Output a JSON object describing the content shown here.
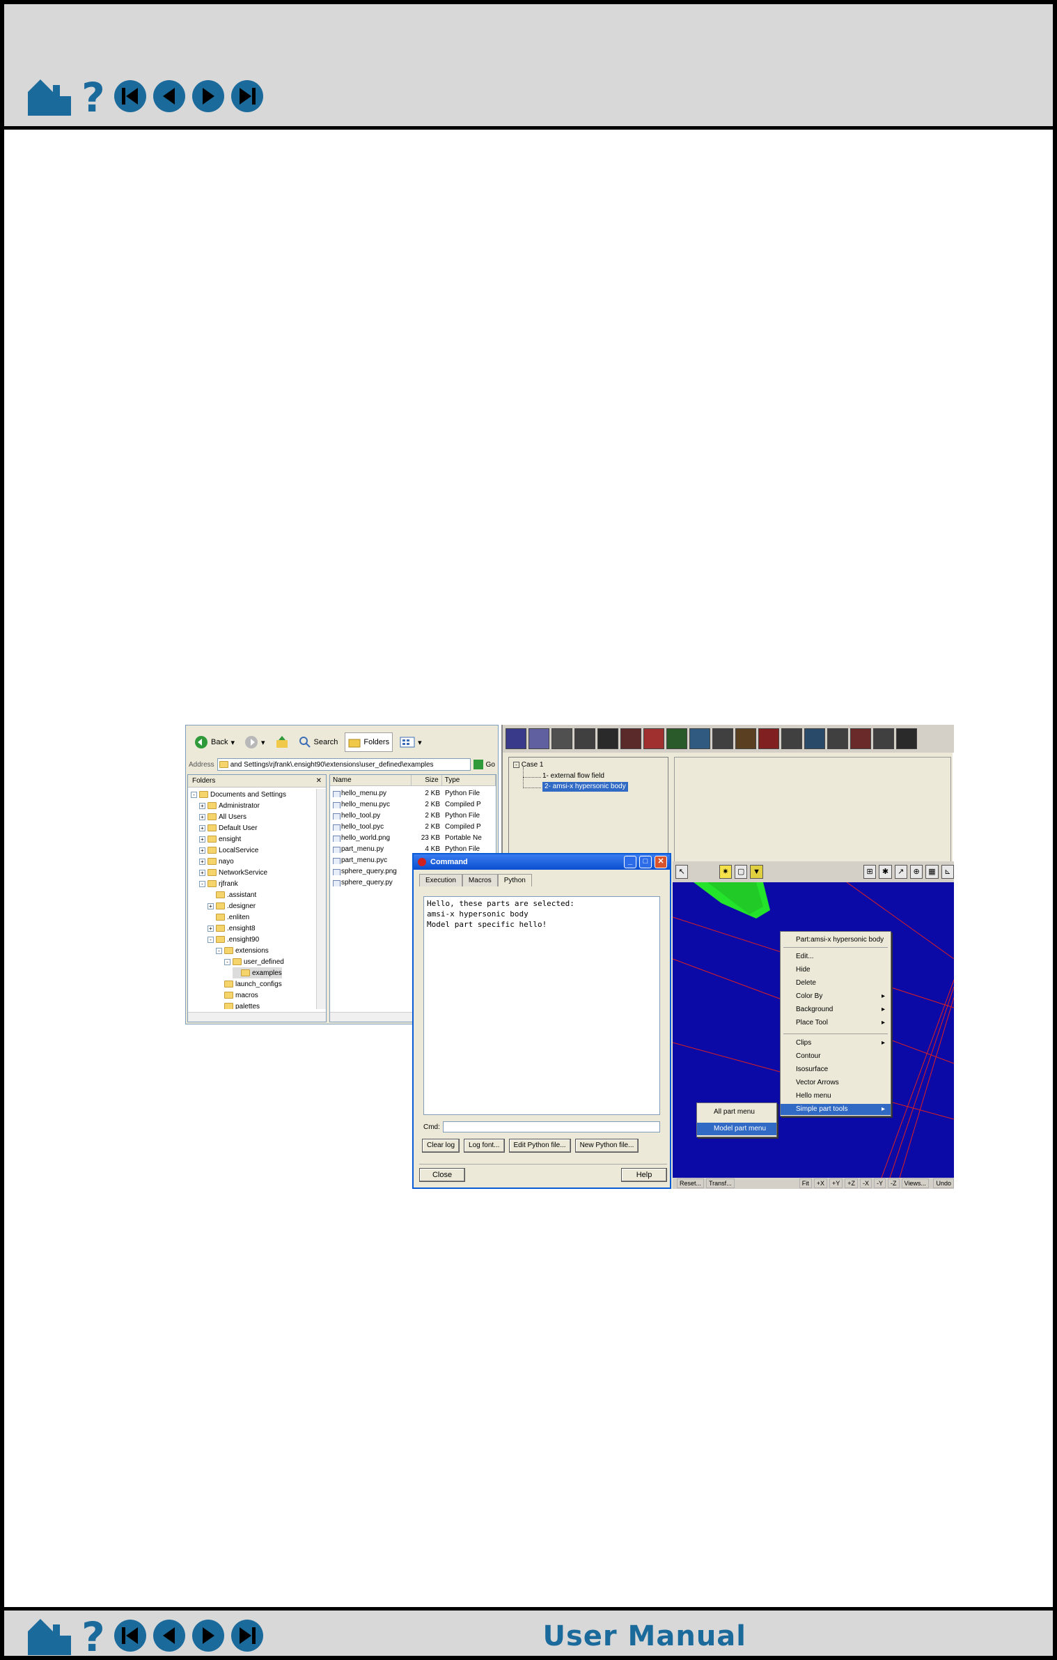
{
  "nav": {
    "icons": [
      "home-icon",
      "help-icon",
      "first-page-icon",
      "previous-page-icon",
      "next-page-icon",
      "last-page-icon"
    ],
    "footer_title": "User Manual",
    "accent_color": "#1b6a9c"
  },
  "explorer": {
    "back_label": "Back",
    "search_label": "Search",
    "folders_label": "Folders",
    "address_label": "Address",
    "address_value": "and Settings\\rjfrank\\.ensight90\\extensions\\user_defined\\examples",
    "go_label": "Go",
    "folders_header": "Folders",
    "tree": [
      {
        "label": "Documents and Settings",
        "pm": "-"
      },
      {
        "label": "Administrator",
        "pm": "+"
      },
      {
        "label": "All Users",
        "pm": "+"
      },
      {
        "label": "Default User",
        "pm": "+"
      },
      {
        "label": "ensight",
        "pm": "+"
      },
      {
        "label": "LocalService",
        "pm": "+"
      },
      {
        "label": "nayo",
        "pm": "+"
      },
      {
        "label": "NetworkService",
        "pm": "+"
      },
      {
        "label": "rjfrank",
        "pm": "-"
      },
      {
        "label": ".assistant",
        "pm": ""
      },
      {
        "label": ".designer",
        "pm": "+"
      },
      {
        "label": ".enliten",
        "pm": ""
      },
      {
        "label": ".ensight8",
        "pm": "+"
      },
      {
        "label": ".ensight90",
        "pm": "-"
      },
      {
        "label": "extensions",
        "pm": "-"
      },
      {
        "label": "user_defined",
        "pm": "-"
      },
      {
        "label": "examples",
        "pm": ""
      },
      {
        "label": "launch_configs",
        "pm": ""
      },
      {
        "label": "macros",
        "pm": ""
      },
      {
        "label": "palettes",
        "pm": ""
      }
    ],
    "columns": {
      "name": "Name",
      "size": "Size",
      "type": "Type"
    },
    "files": [
      {
        "name": "hello_menu.py",
        "size": "2 KB",
        "type": "Python File"
      },
      {
        "name": "hello_menu.pyc",
        "size": "2 KB",
        "type": "Compiled P"
      },
      {
        "name": "hello_tool.py",
        "size": "2 KB",
        "type": "Python File"
      },
      {
        "name": "hello_tool.pyc",
        "size": "2 KB",
        "type": "Compiled P"
      },
      {
        "name": "hello_world.png",
        "size": "23 KB",
        "type": "Portable Ne"
      },
      {
        "name": "part_menu.py",
        "size": "4 KB",
        "type": "Python File"
      },
      {
        "name": "part_menu.pyc",
        "size": "",
        "type": ""
      },
      {
        "name": "sphere_query.png",
        "size": "",
        "type": ""
      },
      {
        "name": "sphere_query.py",
        "size": "",
        "type": ""
      }
    ]
  },
  "ensight": {
    "tree": {
      "case": "Case 1",
      "part1": "1- external flow field",
      "part2": "2- amsi-x hypersonic body"
    },
    "bottom_bar": [
      "Reset...",
      "Transf...",
      "Fit",
      "+X",
      "+Y",
      "+Z",
      "-X",
      "-Y",
      "-Z",
      "Views...",
      "Undo"
    ],
    "context_menu": {
      "header": "Part:amsi-x hypersonic body",
      "items": [
        "Edit...",
        "Hide",
        "Delete",
        "Color By",
        "Background",
        "Place Tool",
        "Clips",
        "Contour",
        "Isosurface",
        "Vector Arrows",
        "Hello menu",
        "Simple part tools"
      ]
    },
    "submenu": [
      "All part menu",
      "Model part menu"
    ]
  },
  "command": {
    "title": "Command",
    "tabs": [
      "Execution",
      "Macros",
      "Python"
    ],
    "output": "Hello, these parts are selected:\namsi-x hypersonic body\nModel part specific hello!",
    "cmd_label": "Cmd:",
    "buttons": [
      "Clear log",
      "Log font...",
      "Edit Python file...",
      "New Python file..."
    ],
    "close_label": "Close",
    "help_label": "Help"
  }
}
